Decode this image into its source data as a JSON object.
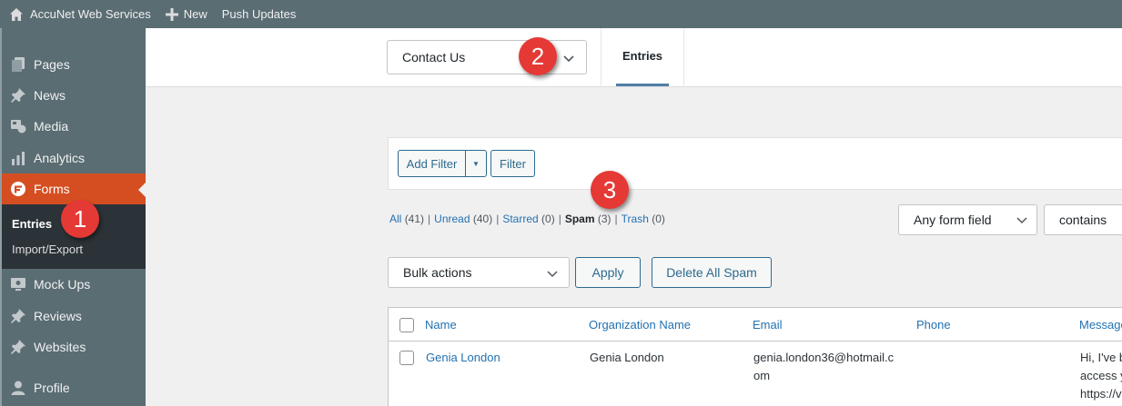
{
  "adminbar": {
    "site_name": "AccuNet Web Services",
    "new_label": "New",
    "push_label": "Push Updates"
  },
  "sidebar": {
    "items": [
      {
        "label": "Pages",
        "icon": "pages-icon"
      },
      {
        "label": "News",
        "icon": "pin-icon"
      },
      {
        "label": "Media",
        "icon": "media-icon"
      },
      {
        "label": "Analytics",
        "icon": "bar-chart-icon"
      },
      {
        "label": "Forms",
        "icon": "forms-icon"
      },
      {
        "label": "Mock Ups",
        "icon": "monitor-icon"
      },
      {
        "label": "Reviews",
        "icon": "pin-icon"
      },
      {
        "label": "Websites",
        "icon": "pin-icon"
      },
      {
        "label": "Profile",
        "icon": "user-icon"
      }
    ],
    "submenu": {
      "entries": "Entries",
      "import_export": "Import/Export"
    }
  },
  "header": {
    "form_selected": "Contact Us",
    "tab_entries": "Entries"
  },
  "filter": {
    "add_filter": "Add Filter",
    "dropdown_arrow": "▼",
    "filter": "Filter"
  },
  "status": {
    "all": "All",
    "all_count": "(41)",
    "unread": "Unread",
    "unread_count": "(40)",
    "starred": "Starred",
    "starred_count": "(0)",
    "spam": "Spam",
    "spam_count": "(3)",
    "trash": "Trash",
    "trash_count": "(0)",
    "separator": "|"
  },
  "search": {
    "field": "Any form field",
    "operator": "contains"
  },
  "bulk": {
    "actions": "Bulk actions",
    "apply": "Apply",
    "delete_spam": "Delete All Spam"
  },
  "table": {
    "columns": [
      "Name",
      "Organization Name",
      "Email",
      "Phone",
      "Message"
    ],
    "rows": [
      {
        "name": "Genia London",
        "organization": "Genia London",
        "email_line1": "genia.london36@hotmail.c",
        "email_line2": "om",
        "phone": "",
        "message_line1": "Hi, I've b",
        "message_line2": "access y",
        "message_line3": "https://v"
      }
    ]
  },
  "annotations": [
    "1",
    "2",
    "3"
  ],
  "colors": {
    "sidebar_bg": "#5a6d73",
    "active_menu": "#d54e21",
    "submenu_bg": "#2c3338",
    "link": "#2271b1",
    "badge": "#e53935"
  }
}
